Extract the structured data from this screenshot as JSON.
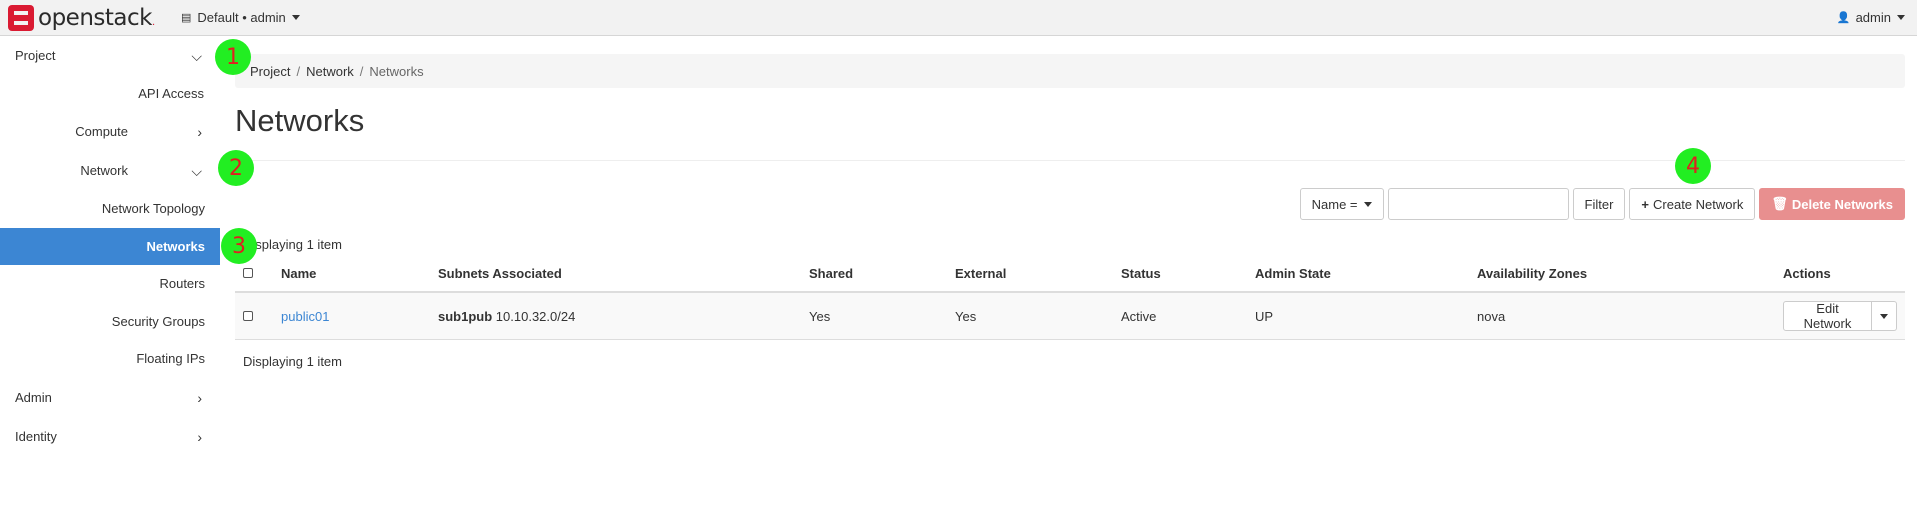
{
  "topbar": {
    "logo_text": "openstack",
    "project_switch": "Default • admin",
    "user": "admin"
  },
  "sidebar": {
    "items": [
      {
        "label": "Project",
        "chevron": "chevron-down-icon"
      },
      {
        "label": "API Access"
      },
      {
        "label": "Compute",
        "chevron": "chevron-right-icon"
      },
      {
        "label": "Network",
        "chevron": "chevron-down-icon"
      },
      {
        "label": "Network Topology"
      },
      {
        "label": "Networks",
        "active": true
      },
      {
        "label": "Routers"
      },
      {
        "label": "Security Groups"
      },
      {
        "label": "Floating IPs"
      },
      {
        "label": "Admin",
        "chevron": "chevron-right-icon"
      },
      {
        "label": "Identity",
        "chevron": "chevron-right-icon"
      }
    ]
  },
  "breadcrumb": [
    "Project",
    "Network",
    "Networks"
  ],
  "page_title": "Networks",
  "filter": {
    "field": "Name =",
    "value": "",
    "filter_label": "Filter",
    "create_label": "Create Network",
    "delete_label": "Delete Networks"
  },
  "displaying": "Displaying 1 item",
  "table": {
    "headers": [
      "Name",
      "Subnets Associated",
      "Shared",
      "External",
      "Status",
      "Admin State",
      "Availability Zones",
      "Actions"
    ],
    "rows": [
      {
        "name": "public01",
        "subnet_name": "sub1pub",
        "subnet_cidr": "10.10.32.0/24",
        "shared": "Yes",
        "external": "Yes",
        "status": "Active",
        "admin_state": "UP",
        "zones": "nova",
        "action": "Edit Network"
      }
    ]
  },
  "markers": [
    "1",
    "2",
    "3",
    "4"
  ],
  "colors": {
    "accent": "#3c86d3",
    "danger": "#e88f8f",
    "marker": "#22ee22",
    "brand": "#da1a32"
  }
}
